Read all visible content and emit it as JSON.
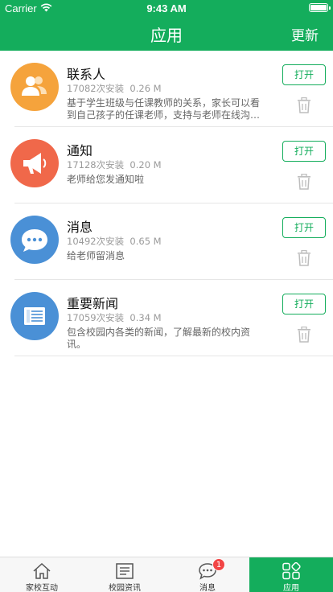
{
  "status_bar": {
    "carrier": "Carrier",
    "time": "9:43 AM"
  },
  "nav": {
    "title": "应用",
    "action_label": "更新"
  },
  "apps": [
    {
      "name": "联系人",
      "installs": "17082次安装",
      "size": "0.26 M",
      "description": "基于学生班级与任课教师的关系，家长可以看到自己孩子的任课老师，支持与老师在线沟通交流。",
      "open_label": "打开",
      "icon": "contacts-icon",
      "color": "#f5a33c"
    },
    {
      "name": "通知",
      "installs": "17128次安装",
      "size": "0.20 M",
      "description": "老师给您发通知啦",
      "open_label": "打开",
      "icon": "megaphone-icon",
      "color": "#f0684a"
    },
    {
      "name": "消息",
      "installs": "10492次安装",
      "size": "0.65 M",
      "description": "给老师留消息",
      "open_label": "打开",
      "icon": "chat-bubble-icon",
      "color": "#4a90d6"
    },
    {
      "name": "重要新闻",
      "installs": "17059次安装",
      "size": "0.34 M",
      "description": "包含校园内各类的新闻，了解最新的校内资讯。",
      "open_label": "打开",
      "icon": "newspaper-icon",
      "color": "#4a90d6"
    }
  ],
  "tabs": [
    {
      "label": "家校互动",
      "icon": "home-icon"
    },
    {
      "label": "校园资讯",
      "icon": "news-icon"
    },
    {
      "label": "消息",
      "icon": "message-icon",
      "badge": "1"
    },
    {
      "label": "应用",
      "icon": "apps-grid-icon",
      "active": true
    }
  ]
}
